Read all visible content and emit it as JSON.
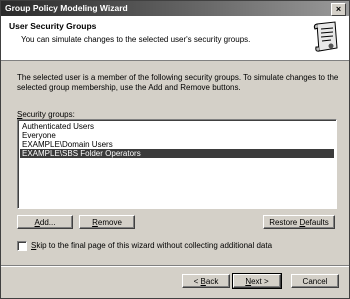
{
  "window": {
    "title": "Group Policy Modeling Wizard",
    "close_glyph": "×"
  },
  "header": {
    "title": "User Security Groups",
    "subtitle": "You can simulate changes to the selected user's security groups.",
    "icon": "scroll-icon"
  },
  "description": "The selected user is a member of the following security groups. To simulate changes to the selected group membership, use the Add and Remove buttons.",
  "groups": {
    "label": "Security groups:",
    "items": [
      "Authenticated Users",
      "Everyone",
      "EXAMPLE\\Domain Users",
      "EXAMPLE\\SBS Folder Operators"
    ],
    "selected_index": 3
  },
  "buttons": {
    "add": {
      "prefix": "",
      "key": "A",
      "rest": "dd..."
    },
    "remove": {
      "prefix": "",
      "key": "R",
      "rest": "emove"
    },
    "restore": {
      "prefix": "Restore ",
      "key": "D",
      "rest": "efaults"
    },
    "back": {
      "prefix": "< ",
      "key": "B",
      "rest": "ack"
    },
    "next": {
      "prefix": "",
      "key": "N",
      "rest": "ext >"
    },
    "cancel": "Cancel"
  },
  "skip": {
    "checked": false,
    "key": "S",
    "rest": "kip to the final page of this wizard without collecting additional data"
  }
}
